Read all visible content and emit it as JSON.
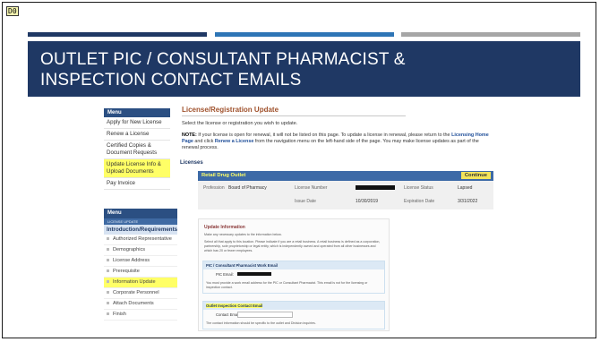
{
  "tag": "D0",
  "slide": {
    "title_line1": "OUTLET PIC / CONSULTANT PHARMACIST &",
    "title_line2": "INSPECTION CONTACT EMAILS"
  },
  "colors": {
    "navy": "#1f3864",
    "blue": "#2e75b6",
    "gray": "#a6a6a6",
    "highlight": "#ffff66"
  },
  "menu": {
    "header": "Menu",
    "items": [
      {
        "label": "Apply for New License"
      },
      {
        "label": "Renew a License"
      },
      {
        "label": "Certified Copies & Document Requests"
      },
      {
        "label": "Update License Info & Upload Documents"
      },
      {
        "label": "Pay Invoice"
      }
    ]
  },
  "license_menu": {
    "header": "Menu",
    "subheader": "LICENSE UPDATE",
    "section": "Introduction/Requirements",
    "items": [
      {
        "label": "Authorized Representative"
      },
      {
        "label": "Demographics"
      },
      {
        "label": "License Address"
      },
      {
        "label": "Prerequisite"
      },
      {
        "label": "Information Update"
      },
      {
        "label": "Corporate Personnel"
      },
      {
        "label": "Attach Documents"
      },
      {
        "label": "Finish"
      }
    ]
  },
  "page": {
    "title": "License/Registration Update",
    "instruction": "Select the license or registration you wish to update.",
    "note_label": "NOTE:",
    "note_text": "If your license is open for renewal, it will not be listed on this page. To update a license in renewal, please return to the",
    "note_link1": "Licensing Home Page",
    "note_text2": "and click",
    "note_link2": "Renew a License",
    "note_text3": "from the navigation menu on the left-hand side of the page. You may make license updates as part of the renewal process.",
    "licenses_label": "Licenses"
  },
  "license_card": {
    "title": "Retail Drug Outlet",
    "continue": "Continue",
    "profession_label": "Profession",
    "profession_value": "Board of Pharmacy",
    "number_label": "License Number",
    "status_label": "License Status",
    "status_value": "Lapsed",
    "issue_label": "Issue Date",
    "issue_value": "10/30/2019",
    "exp_label": "Expiration Date",
    "exp_value": "3/31/2022"
  },
  "update_panel": {
    "title": "Update Information",
    "desc1": "Make any necessary updates to the information below.",
    "desc2": "Select all that apply to this location. Please indicate if you are a retail business. A retail business is defined as a corporation, partnership, sole proprietorship or legal entity, which is independently owned and operated from all other businesses and which has 20 or fewer employees.",
    "pic_header": "PIC / Consultant Pharmacist Work Email",
    "pic_label": "PIC Email:",
    "pic_note": "You must provide a work email address for the PIC or Consultant Pharmacist. This email is not for the licensing or inspection contact.",
    "insp_header": "Outlet Inspection Contact Email",
    "insp_label": "Contact Email:",
    "insp_note": "The contact information should be specific to the outlet and Division inquiries."
  }
}
